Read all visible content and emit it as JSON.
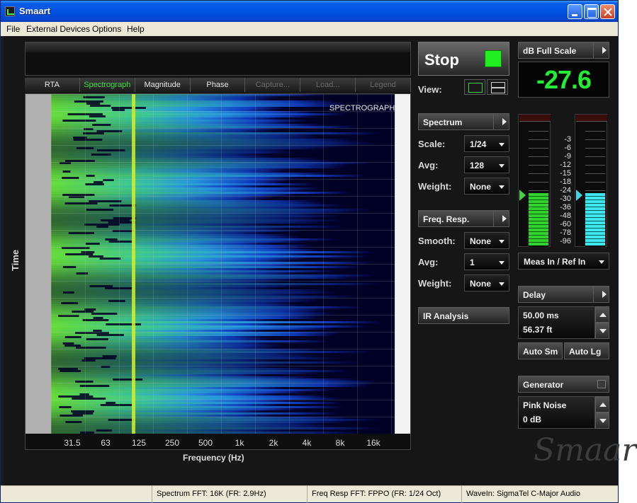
{
  "window": {
    "title": "Smaart"
  },
  "menu": [
    "File",
    "External Devices",
    "Options",
    "Help"
  ],
  "tabs": [
    {
      "label": "RTA",
      "state": "normal"
    },
    {
      "label": "Spectrograph",
      "state": "active"
    },
    {
      "label": "Magnitude",
      "state": "normal"
    },
    {
      "label": "Phase",
      "state": "normal"
    },
    {
      "label": "Capture...",
      "state": "disabled"
    },
    {
      "label": "Load...",
      "state": "disabled"
    },
    {
      "label": "Legend",
      "state": "disabled"
    }
  ],
  "plot": {
    "overlay_label": "SPECTROGRAPH [INS",
    "y_label": "Time",
    "x_label": "Frequency (Hz)",
    "x_ticks": [
      "31.5",
      "63",
      "125",
      "250",
      "500",
      "1k",
      "2k",
      "4k",
      "8k",
      "16k"
    ]
  },
  "controls": {
    "stop_label": "Stop",
    "view_label": "View:",
    "spectrum_label": "Spectrum",
    "spectrum_scale_label": "Scale:",
    "spectrum_scale_value": "1/24",
    "spectrum_avg_label": "Avg:",
    "spectrum_avg_value": "128",
    "spectrum_weight_label": "Weight:",
    "spectrum_weight_value": "None",
    "freqresp_label": "Freq. Resp.",
    "freqresp_smooth_label": "Smooth:",
    "freqresp_smooth_value": "None",
    "freqresp_avg_label": "Avg:",
    "freqresp_avg_value": "1",
    "freqresp_weight_label": "Weight:",
    "freqresp_weight_value": "None",
    "ir_label": "IR Analysis"
  },
  "meters": {
    "fullscale_label": "dB Full Scale",
    "level_value": "-27.6",
    "scale": [
      "-3",
      "-6",
      "-9",
      "-12",
      "-15",
      "-18",
      "-24",
      "-30",
      "-36",
      "-48",
      "-60",
      "-78",
      "-96"
    ],
    "meas_level": 0.42,
    "ref_level": 0.42,
    "input_select": "Meas In / Ref In"
  },
  "delay": {
    "label": "Delay",
    "ms_value": "50.00 ms",
    "ft_value": "56.37 ft",
    "auto_sm": "Auto Sm",
    "auto_lg": "Auto Lg"
  },
  "generator": {
    "label": "Generator",
    "signal": "Pink Noise",
    "level": "0 dB"
  },
  "logo_text": "Smaart",
  "status": {
    "spectrum_fft": "Spectrum FFT: 16K (FR: 2.9Hz)",
    "freq_resp_fft": "Freq Resp FFT: FPPO (FR: 1/24 Oct)",
    "wave_in": "WaveIn: SigmaTel C-Major Audio"
  },
  "colors": {
    "accent_green": "#22ee33",
    "meter_green": "#31d22f",
    "meter_cyan": "#3fe6ee",
    "titlebar_blue": "#0054e3"
  }
}
